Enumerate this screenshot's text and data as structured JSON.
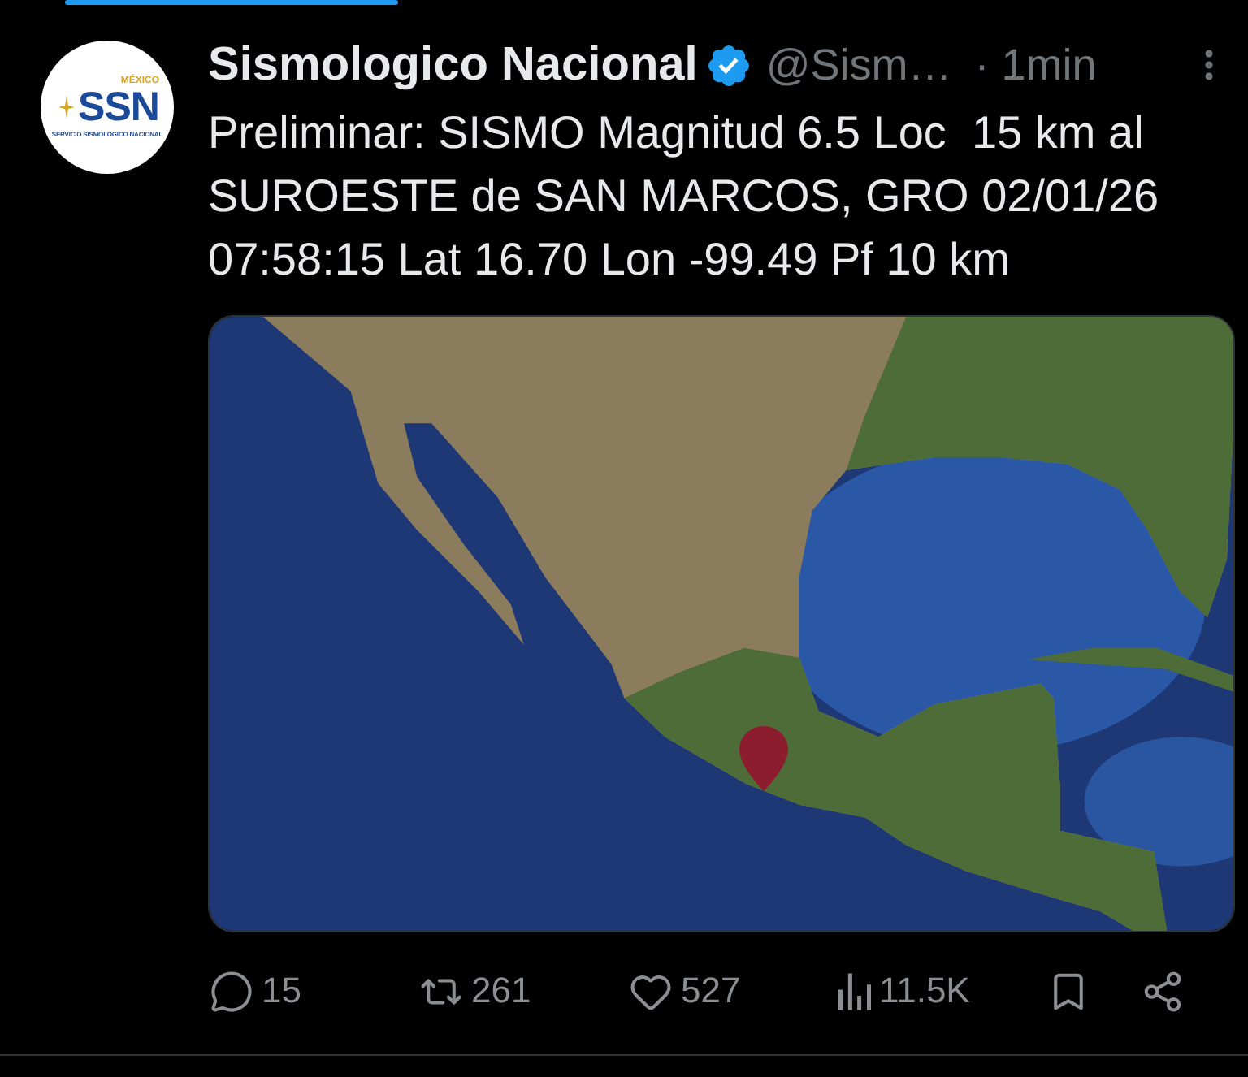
{
  "tweet": {
    "avatar": {
      "logo_tagline": "MÉXICO",
      "logo_text": "SSN",
      "logo_subtitle": "SERVICIO SISMOLOGICO NACIONAL"
    },
    "author": {
      "name": "Sismologico Nacional",
      "verified": true,
      "handle": "@Sism…",
      "time": "· 1min"
    },
    "text": "Preliminar: SISMO Magnitud 6.5 Loc  15 km al SUROESTE de SAN MARCOS, GRO 02/01/26 07:58:15 Lat 16.70 Lon -99.49 Pf 10 km",
    "media": {
      "kind": "map"
    },
    "actions": [
      {
        "kind": "reply",
        "count": "15"
      },
      {
        "kind": "repost",
        "count": "261"
      },
      {
        "kind": "like",
        "count": "527"
      },
      {
        "kind": "views",
        "count": "11.5K"
      },
      {
        "kind": "bookmark"
      },
      {
        "kind": "share"
      }
    ]
  }
}
